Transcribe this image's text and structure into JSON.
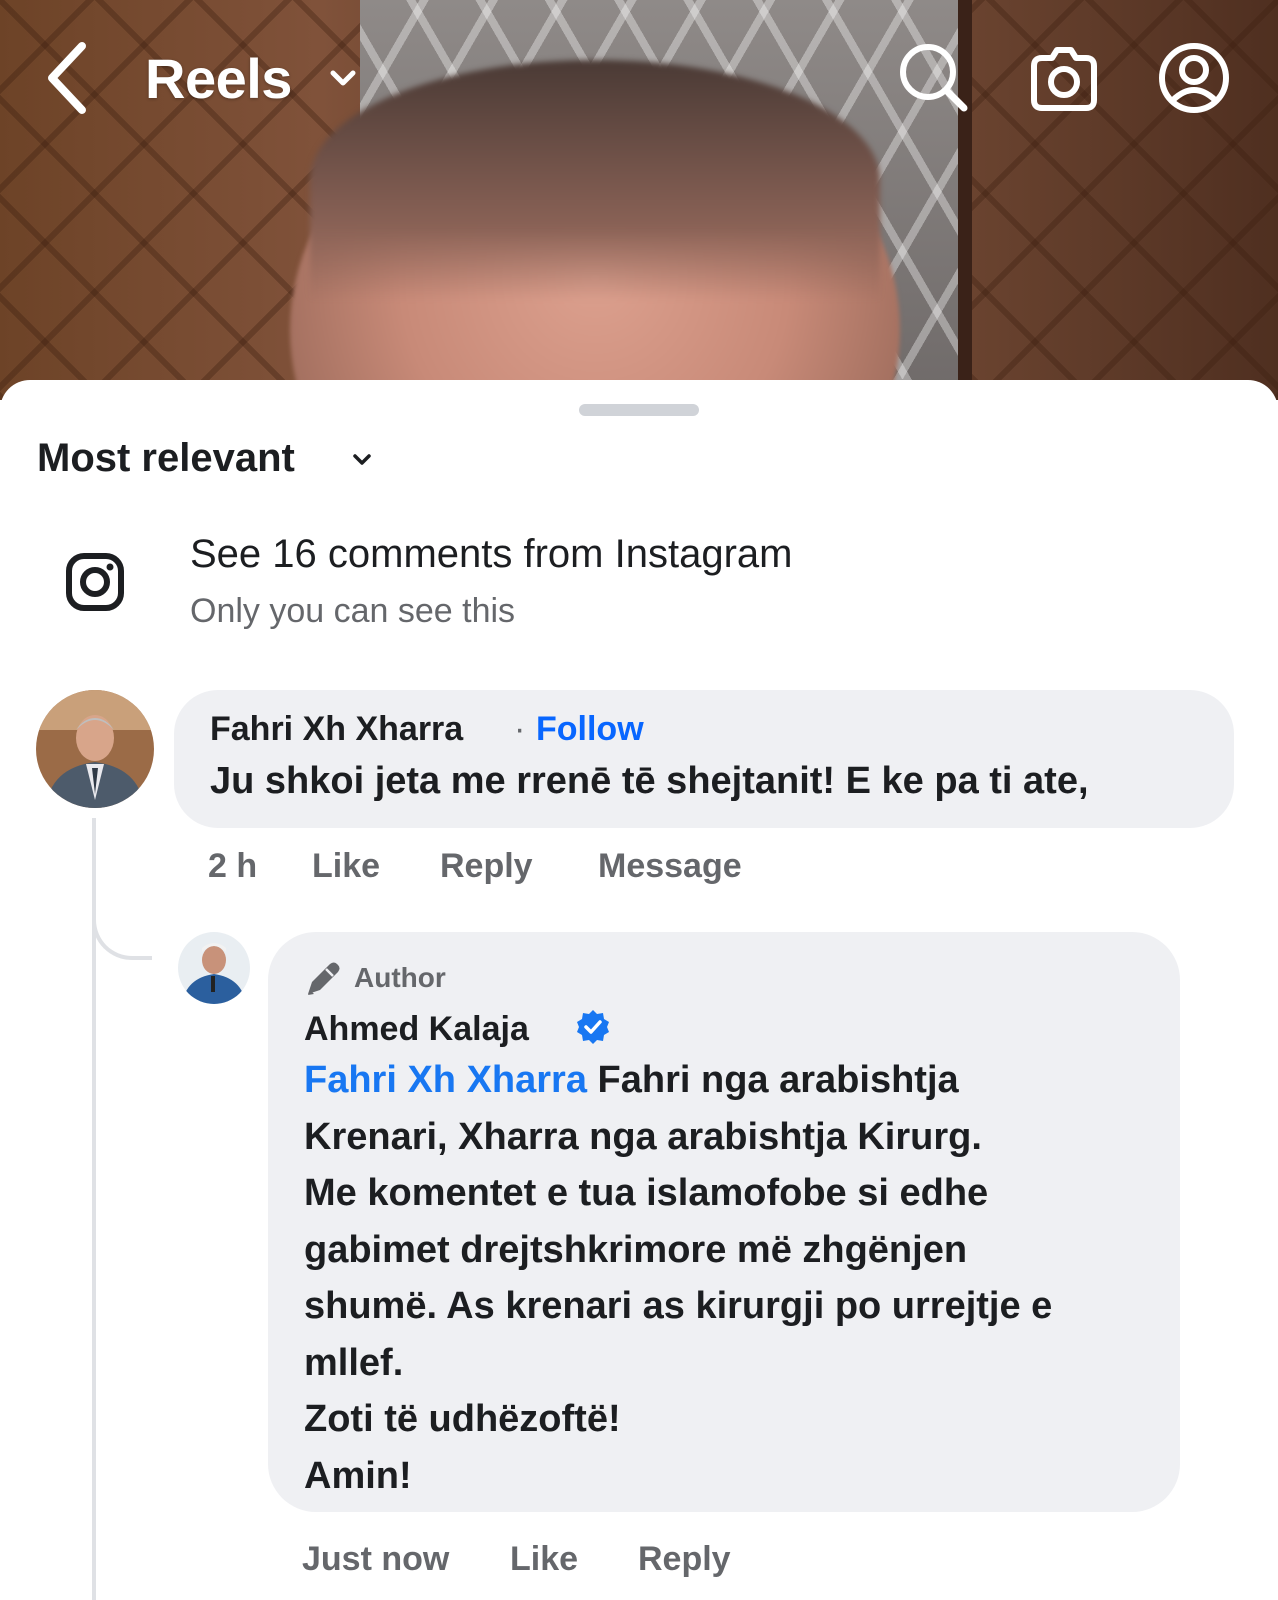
{
  "header": {
    "title": "Reels"
  },
  "icons": {
    "back": "back-chevron-icon",
    "dropdown": "chevron-down-icon",
    "search": "search-icon",
    "camera": "camera-icon",
    "profile": "profile-icon",
    "instagram": "instagram-icon",
    "author": "pencil-icon",
    "verified": "verified-badge-icon"
  },
  "colors": {
    "link": "#0866ff",
    "mention": "#1877f2",
    "bubble": "#eff0f3",
    "muted": "#65676b"
  },
  "sort": {
    "label": "Most relevant"
  },
  "instagram_prompt": {
    "title": "See 16 comments from Instagram",
    "subtitle": "Only you can see this"
  },
  "comments": [
    {
      "author": "Fahri Xh Xharra",
      "separator": "·",
      "follow_label": "Follow",
      "text": "Ju shkoi jeta me rrenē tē shejtanit! E ke pa ti ate,",
      "time": "2 h",
      "actions": {
        "like": "Like",
        "reply": "Reply",
        "message": "Message"
      }
    }
  ],
  "reply": {
    "badge": "Author",
    "author": "Ahmed Kalaja",
    "mention": "Fahri Xh Xharra",
    "lines": [
      " Fahri nga arabishtja",
      "Krenari, Xharra nga arabishtja Kirurg.",
      "Me komentet e tua islamofobe si edhe",
      "gabimet drejtshkrimore më zhgënjen",
      "shumë. As krenari as kirurgji po urrejtje e",
      "mllef.",
      "Zoti të udhëzoftë!",
      "Amin!"
    ],
    "time": "Just now",
    "actions": {
      "like": "Like",
      "reply": "Reply"
    }
  }
}
